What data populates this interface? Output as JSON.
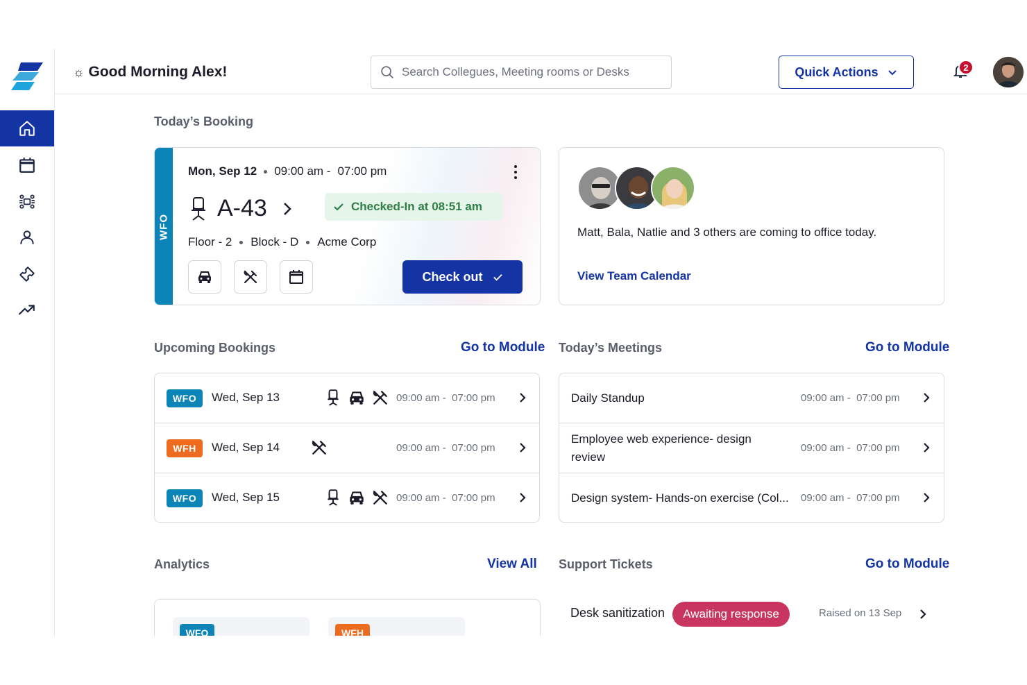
{
  "header": {
    "greeting": "Good Morning Alex!",
    "greeting_icon": "sun-icon",
    "search_placeholder": "Search Collegues, Meeting rooms or Desks",
    "quick_actions": "Quick Actions",
    "notification_count": "2"
  },
  "sidebar": {
    "items": [
      {
        "name": "home",
        "icon": "home-icon",
        "active": true
      },
      {
        "name": "calendar",
        "icon": "calendar-icon"
      },
      {
        "name": "meeting-rooms",
        "icon": "meeting-table-icon"
      },
      {
        "name": "people",
        "icon": "person-icon"
      },
      {
        "name": "tickets",
        "icon": "ticket-icon"
      },
      {
        "name": "analytics",
        "icon": "trend-up-icon"
      }
    ]
  },
  "todays_booking": {
    "section_title": "Today’s Booking",
    "work_mode": "WFO",
    "date": "Mon, Sep 12",
    "start_time": "09:00 am -",
    "end_time": "07:00 pm",
    "desk": "A-43",
    "status": "Checked-In at 08:51 am",
    "floor": "Floor - 2",
    "block": "Block - D",
    "company": "Acme Corp",
    "checkout_label": "Check out",
    "accent": "#0c84b8"
  },
  "team": {
    "message": "Matt, Bala, Natlie and 3 others are coming to office today.",
    "link": "View Team Calendar"
  },
  "upcoming": {
    "section_title": "Upcoming Bookings",
    "link": "Go to Module",
    "rows": [
      {
        "tag": "WFO",
        "date": "Wed, Sep 13",
        "start": "09:00 am -",
        "end": "07:00 pm",
        "amenities": [
          "desk-icon",
          "car-icon",
          "meal-icon"
        ]
      },
      {
        "tag": "WFH",
        "date": "Wed, Sep 14",
        "start": "09:00 am -",
        "end": "07:00 pm",
        "amenities": [
          "meal-icon"
        ]
      },
      {
        "tag": "WFO",
        "date": "Wed, Sep 15",
        "start": "09:00 am -",
        "end": "07:00 pm",
        "amenities": [
          "desk-icon",
          "car-icon",
          "meal-icon"
        ]
      }
    ]
  },
  "meetings": {
    "section_title": "Today’s Meetings",
    "link": "Go to Module",
    "rows": [
      {
        "title": "Daily Standup",
        "start": "09:00 am -",
        "end": "07:00 pm"
      },
      {
        "title": "Employee web experience- design review",
        "start": "09:00 am -",
        "end": "07:00 pm"
      },
      {
        "title": "Design system- Hands-on exercise (Col...",
        "start": "09:00 am -",
        "end": "07:00 pm"
      }
    ]
  },
  "analytics": {
    "section_title": "Analytics",
    "link": "View All",
    "tags": [
      "WFO",
      "WFH"
    ]
  },
  "support": {
    "section_title": "Support Tickets",
    "link": "Go to Module",
    "ticket": {
      "title": "Desk sanitization",
      "status": "Awaiting response",
      "raised": "Raised on 13 Sep"
    }
  },
  "colors": {
    "primary": "#1434a4",
    "wfo": "#0c84b8",
    "wfh": "#ec6b1f",
    "awaiting": "#c8365f",
    "success": "#2e7d46"
  }
}
